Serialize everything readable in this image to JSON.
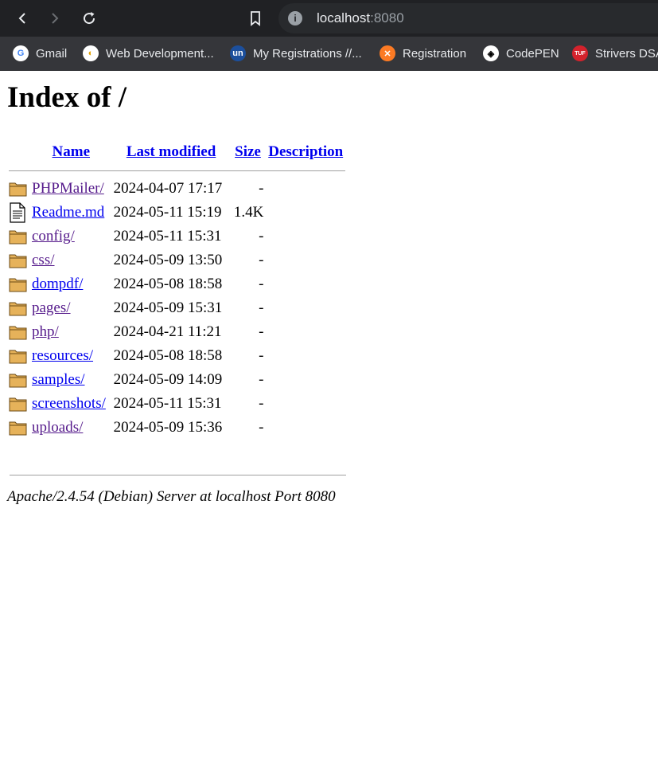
{
  "browser": {
    "url_host": "localhost",
    "url_port": ":8080",
    "bookmarks": [
      {
        "label": "Gmail",
        "icon": "gmail-icon",
        "bg": "#ffffff",
        "glyph": "G",
        "fg": "#4285f4"
      },
      {
        "label": "Web Development...",
        "icon": "web-dev-icon",
        "bg": "#ffffff",
        "glyph": "◐",
        "fg": "#e0a000"
      },
      {
        "label": "My Registrations //...",
        "icon": "unstop-icon",
        "bg": "#1c4f9c",
        "glyph": "un",
        "fg": "#ffffff"
      },
      {
        "label": "Registration",
        "icon": "xampp-icon",
        "bg": "#fb7a24",
        "glyph": "✕",
        "fg": "#ffffff"
      },
      {
        "label": "CodePEN",
        "icon": "codepen-icon",
        "bg": "#ffffff",
        "glyph": "◈",
        "fg": "#000000"
      },
      {
        "label": "Strivers DSA",
        "icon": "tuf-icon",
        "bg": "#d4222c",
        "glyph": "TUF",
        "fg": "#ffffff"
      }
    ]
  },
  "page": {
    "title": "Index of /",
    "columns": {
      "name": "Name",
      "last_modified": "Last modified",
      "size": "Size",
      "description": "Description"
    },
    "rows": [
      {
        "name": "PHPMailer/",
        "modified": "2024-04-07 17:17",
        "size": "-",
        "type": "folder",
        "visited": true
      },
      {
        "name": "Readme.md",
        "modified": "2024-05-11 15:19",
        "size": "1.4K",
        "type": "file",
        "visited": false
      },
      {
        "name": "config/",
        "modified": "2024-05-11 15:31",
        "size": "-",
        "type": "folder",
        "visited": true
      },
      {
        "name": "css/",
        "modified": "2024-05-09 13:50",
        "size": "-",
        "type": "folder",
        "visited": true
      },
      {
        "name": "dompdf/",
        "modified": "2024-05-08 18:58",
        "size": "-",
        "type": "folder",
        "visited": false
      },
      {
        "name": "pages/",
        "modified": "2024-05-09 15:31",
        "size": "-",
        "type": "folder",
        "visited": true
      },
      {
        "name": "php/",
        "modified": "2024-04-21 11:21",
        "size": "-",
        "type": "folder",
        "visited": true
      },
      {
        "name": "resources/",
        "modified": "2024-05-08 18:58",
        "size": "-",
        "type": "folder",
        "visited": false
      },
      {
        "name": "samples/",
        "modified": "2024-05-09 14:09",
        "size": "-",
        "type": "folder",
        "visited": false
      },
      {
        "name": "screenshots/",
        "modified": "2024-05-11 15:31",
        "size": "-",
        "type": "folder",
        "visited": false
      },
      {
        "name": "uploads/",
        "modified": "2024-05-09 15:36",
        "size": "-",
        "type": "folder",
        "visited": true
      }
    ],
    "footer": "Apache/2.4.54 (Debian) Server at localhost Port 8080"
  }
}
